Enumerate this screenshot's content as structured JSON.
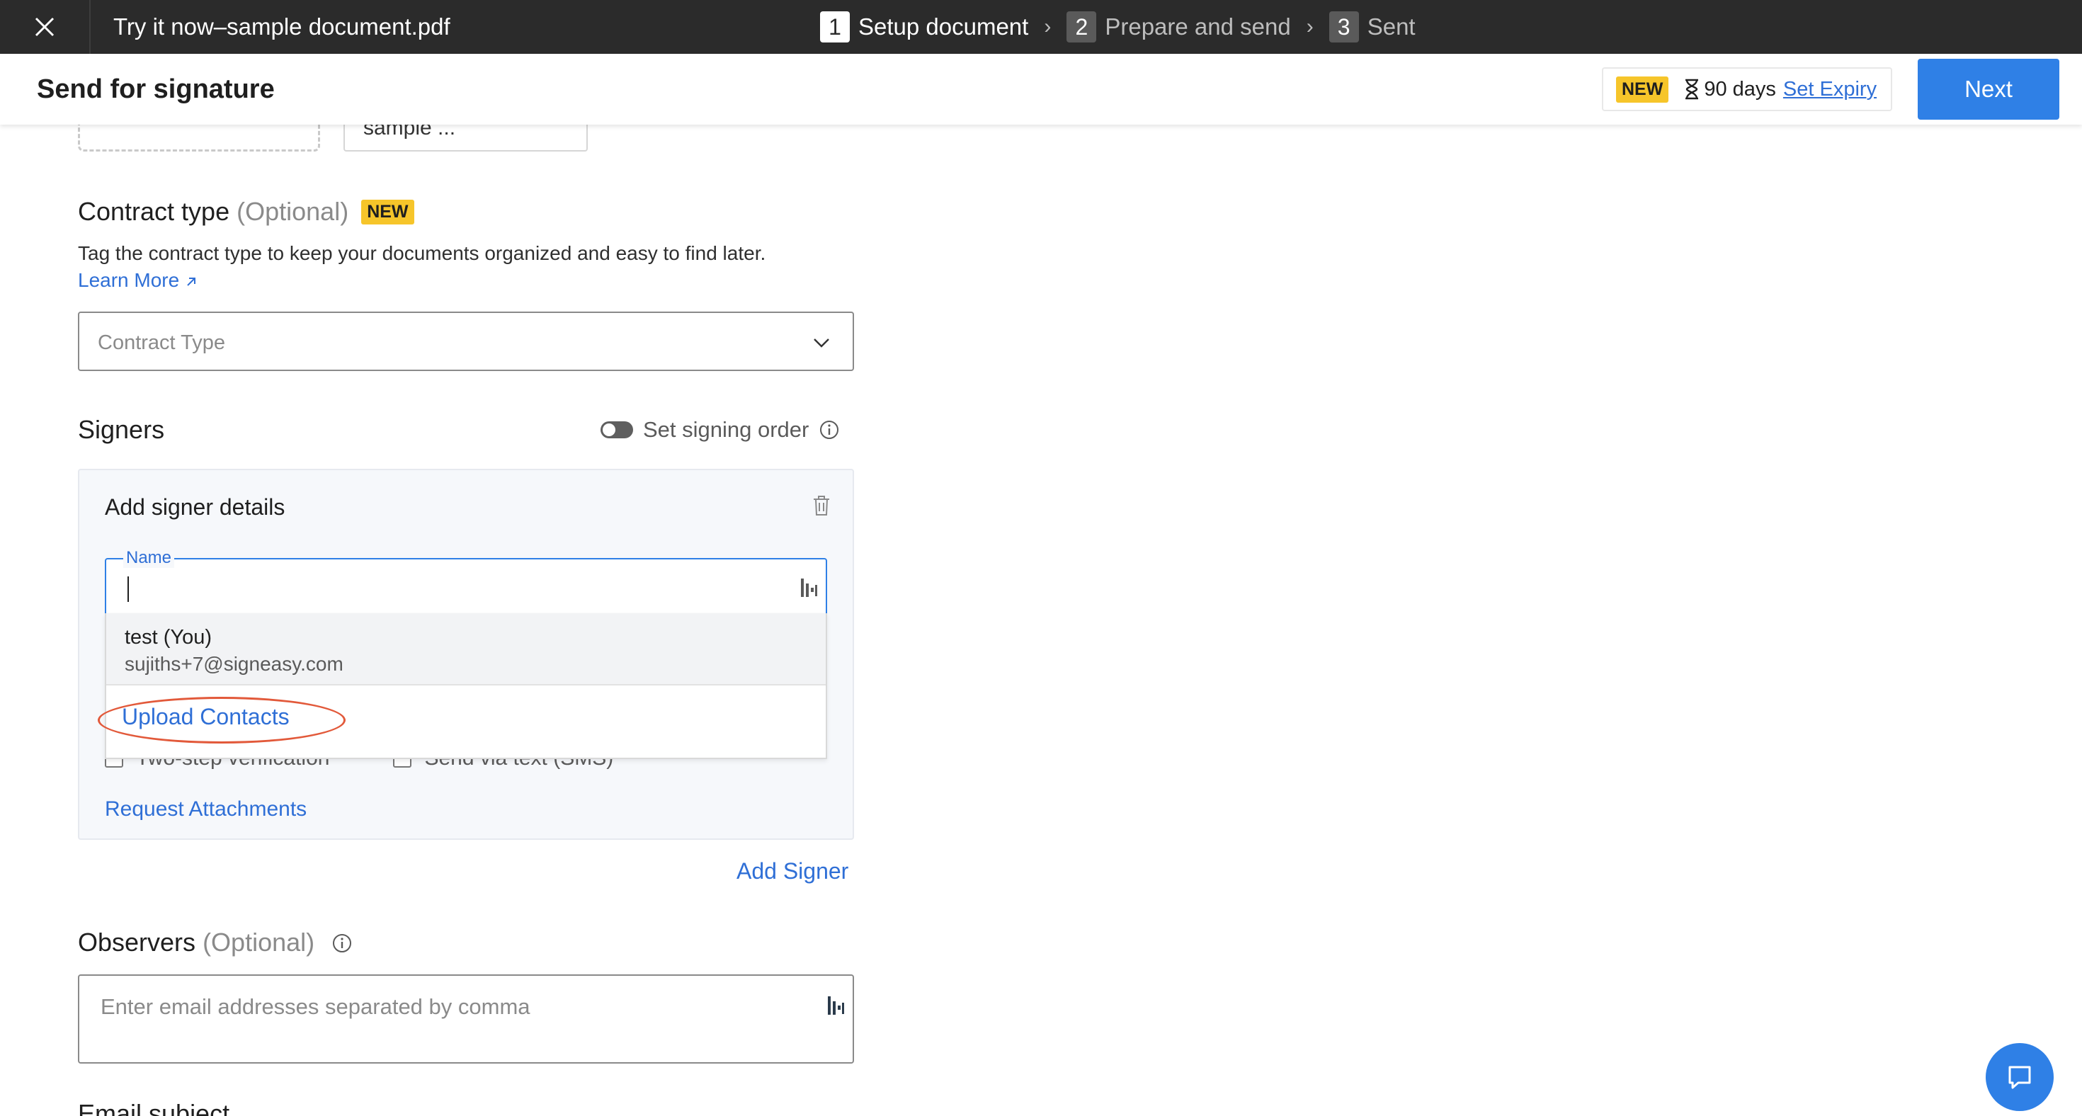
{
  "topbar": {
    "document_title": "Try it now–sample document.pdf",
    "steps": [
      {
        "number": "1",
        "label": "Setup document",
        "active": true
      },
      {
        "number": "2",
        "label": "Prepare and send",
        "active": false
      },
      {
        "number": "3",
        "label": "Sent",
        "active": false
      }
    ]
  },
  "header": {
    "page_title": "Send for signature",
    "badge": "NEW",
    "expiry_days": "90 days",
    "expiry_link": "Set Expiry",
    "next_label": "Next"
  },
  "top_fields": {
    "sample_text": "sample ..."
  },
  "contract_type": {
    "title": "Contract type",
    "optional": "(Optional)",
    "badge": "NEW",
    "description": "Tag the contract type to keep your documents organized and easy to find later.",
    "learn_more": "Learn More",
    "placeholder": "Contract Type"
  },
  "signers": {
    "title": "Signers",
    "signing_order_label": "Set signing order",
    "card_title": "Add signer details",
    "name_label": "Name",
    "options": [
      "Two-step verification",
      "Send via text (SMS)"
    ],
    "request_attachments": "Request Attachments",
    "add_signer": "Add Signer",
    "suggestion": {
      "name": "test (You)",
      "email": "sujiths+7@signeasy.com"
    },
    "upload_contacts": "Upload Contacts"
  },
  "observers": {
    "title": "Observers",
    "optional": "(Optional)",
    "placeholder": "Enter email addresses separated by comma"
  },
  "email_subject": {
    "title": "Email subject"
  },
  "colors": {
    "accent": "#2f80e6",
    "link": "#2f6fd6",
    "badge": "#f6c52a",
    "highlight": "#e2593a",
    "topbar": "#2b2b2b"
  }
}
